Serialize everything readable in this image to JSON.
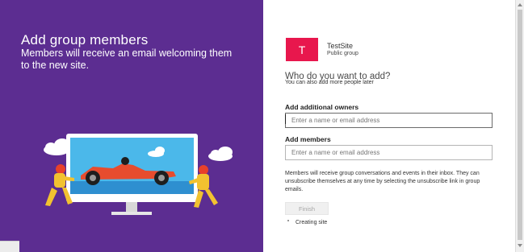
{
  "left": {
    "title": "Add group members",
    "subtitle": "Members will receive an email welcoming them to the new site."
  },
  "site": {
    "initial": "T",
    "name": "TestSite",
    "type": "Public group",
    "tile_color": "#e8174d"
  },
  "form": {
    "question": "Who do you want to add?",
    "question_sub": "You can also add more people later",
    "owners_label": "Add additional owners",
    "owners_placeholder": "Enter a name or email address",
    "owners_value": "",
    "members_label": "Add members",
    "members_placeholder": "Enter a name or email address",
    "members_value": "",
    "info": "Members will receive group conversations and events in their inbox. They can unsubscribe themselves at any time by selecting the unsubscribe link in group emails.",
    "finish_label": "Finish",
    "status": "Creating site"
  },
  "colors": {
    "panel": "#5c2d91",
    "accent": "#e8174d"
  }
}
